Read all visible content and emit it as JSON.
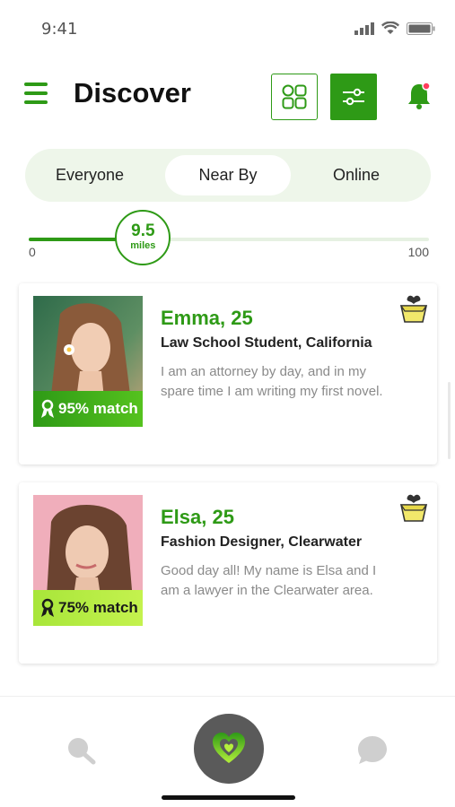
{
  "status": {
    "time": "9:41"
  },
  "header": {
    "title": "Discover"
  },
  "tabs": [
    {
      "label": "Everyone",
      "active": false
    },
    {
      "label": "Near By",
      "active": true
    },
    {
      "label": "Online",
      "active": false
    }
  ],
  "distance": {
    "value": "9.5",
    "unit": "miles",
    "min": "0",
    "max": "100",
    "fraction": 0.095
  },
  "profiles": [
    {
      "name": "Emma, 25",
      "role": "Law School Student, California",
      "bio": "I am an attorney by day, and in my spare time I am writing my first novel.",
      "match": "95% match",
      "match_color": "#2e9a16",
      "match_text_color": "#ffffff"
    },
    {
      "name": "Elsa, 25",
      "role": "Fashion Designer, Clearwater",
      "bio": "Good day all! My name is Elsa and I am a lawyer in the Clearwater area.",
      "match": "75% match",
      "match_color": "#a8e63a",
      "match_text_color": "#1a1a1a"
    }
  ],
  "colors": {
    "accent": "#2e9a16",
    "lime": "#a8e63a",
    "basket": "#f2e86b"
  },
  "icons": [
    "menu-icon",
    "grid-icon",
    "filter-icon",
    "bell-icon",
    "basket-icon",
    "ribbon-icon",
    "search-icon",
    "heart-icon",
    "chat-icon"
  ]
}
